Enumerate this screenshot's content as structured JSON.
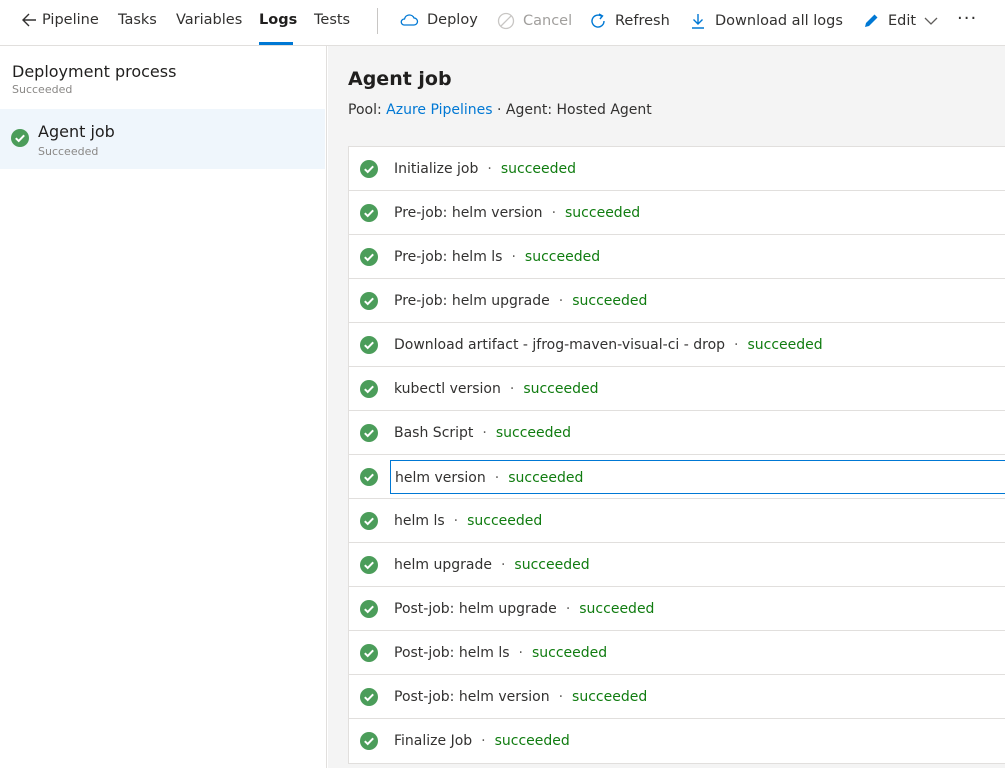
{
  "toolbar": {
    "back_label": "Pipeline",
    "tabs": [
      "Tasks",
      "Variables",
      "Logs",
      "Tests"
    ],
    "active_tab": "Logs",
    "deploy_label": "Deploy",
    "cancel_label": "Cancel",
    "refresh_label": "Refresh",
    "download_label": "Download all logs",
    "edit_label": "Edit",
    "more_label": "···"
  },
  "left_panel": {
    "title": "Deployment process",
    "subtitle": "Succeeded",
    "job": {
      "title": "Agent job",
      "status": "Succeeded"
    }
  },
  "main": {
    "title": "Agent job",
    "pool_label": "Pool:",
    "pool_link": "Azure Pipelines",
    "separator": "·",
    "agent_label": "Agent: Hosted Agent",
    "steps": [
      {
        "name": "Initialize job",
        "status": "succeeded"
      },
      {
        "name": "Pre-job: helm version",
        "status": "succeeded"
      },
      {
        "name": "Pre-job: helm ls",
        "status": "succeeded"
      },
      {
        "name": "Pre-job: helm upgrade",
        "status": "succeeded"
      },
      {
        "name": "Download artifact - jfrog-maven-visual-ci - drop",
        "status": "succeeded"
      },
      {
        "name": "kubectl version",
        "status": "succeeded"
      },
      {
        "name": "Bash Script",
        "status": "succeeded"
      },
      {
        "name": "helm version",
        "status": "succeeded"
      },
      {
        "name": "helm ls",
        "status": "succeeded"
      },
      {
        "name": "helm upgrade",
        "status": "succeeded"
      },
      {
        "name": "Post-job: helm upgrade",
        "status": "succeeded"
      },
      {
        "name": "Post-job: helm ls",
        "status": "succeeded"
      },
      {
        "name": "Post-job: helm version",
        "status": "succeeded"
      },
      {
        "name": "Finalize Job",
        "status": "succeeded"
      }
    ],
    "selected_step": "helm version"
  },
  "colors": {
    "accent": "#0078d4",
    "success": "#107c10",
    "success_icon": "#4b9d5a",
    "selected_bg": "#eff6fc"
  },
  "icons": {
    "back": "arrow-left-icon",
    "deploy": "cloud-icon",
    "cancel": "cancel-circle-icon",
    "refresh": "refresh-icon",
    "download": "download-icon",
    "edit": "pencil-icon",
    "status": "check-circle-icon"
  }
}
